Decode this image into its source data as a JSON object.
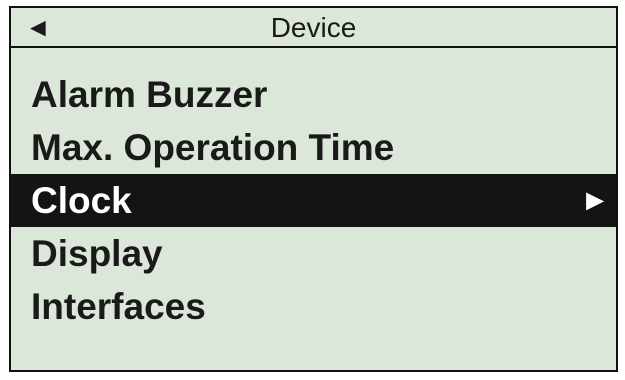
{
  "header": {
    "back_icon": "◄",
    "title": "Device"
  },
  "menu": {
    "items": [
      {
        "label": "Alarm Buzzer"
      },
      {
        "label": "Max. Operation Time"
      },
      {
        "label": "Clock",
        "arrow": "►"
      },
      {
        "label": "Display"
      },
      {
        "label": "Interfaces"
      }
    ],
    "selected_index": 2
  },
  "colors": {
    "screen_background": "#dbe7d8",
    "selection_background": "#141414",
    "selection_text": "#ffffff",
    "text": "#1a1a1a"
  }
}
